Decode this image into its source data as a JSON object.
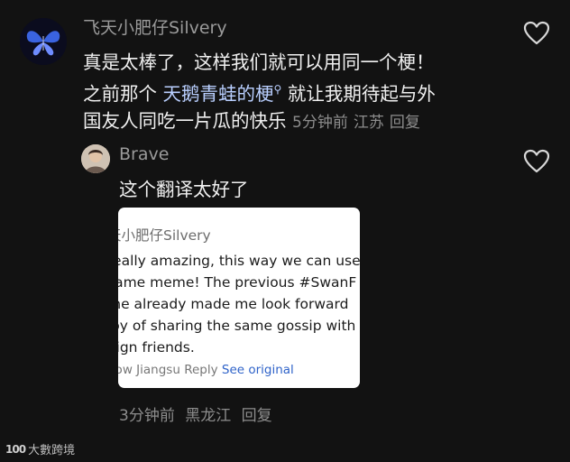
{
  "comment": {
    "author": "飞天小肥仔Silvery",
    "text_line1": "真是太棒了，这样我们就可以用同一个梗！",
    "text_line2_pre": "之前那个 ",
    "hashtag": "天鹅青蛙的梗",
    "text_line2_post": " 就让我期待起与外",
    "text_line3": "国友人同吃一片瓜的快乐",
    "time": "5分钟前",
    "location": "江苏",
    "reply_label": "回复"
  },
  "reply": {
    "author": "Brave",
    "text": "这个翻译太好了",
    "time": "3分钟前",
    "location": "黑龙江",
    "reply_label": "回复",
    "card": {
      "author": "天小肥仔Silvery",
      "lines": [
        "really amazing, this way we can use",
        "same meme! The previous #SwanF",
        "me already made me look forward",
        "joy of sharing the same gossip with",
        "eign friends."
      ],
      "meta_time": "now",
      "meta_location": "Jiangsu",
      "meta_reply": "Reply",
      "see_original": "See original"
    }
  },
  "watermark": {
    "logo": "100",
    "text": "大數跨境"
  },
  "icons": {
    "like": "heart-outline-icon",
    "search": "search-mini-icon"
  },
  "colors": {
    "background": "#121212",
    "hashtag": "#b9cfff",
    "link": "#2f63c9"
  }
}
